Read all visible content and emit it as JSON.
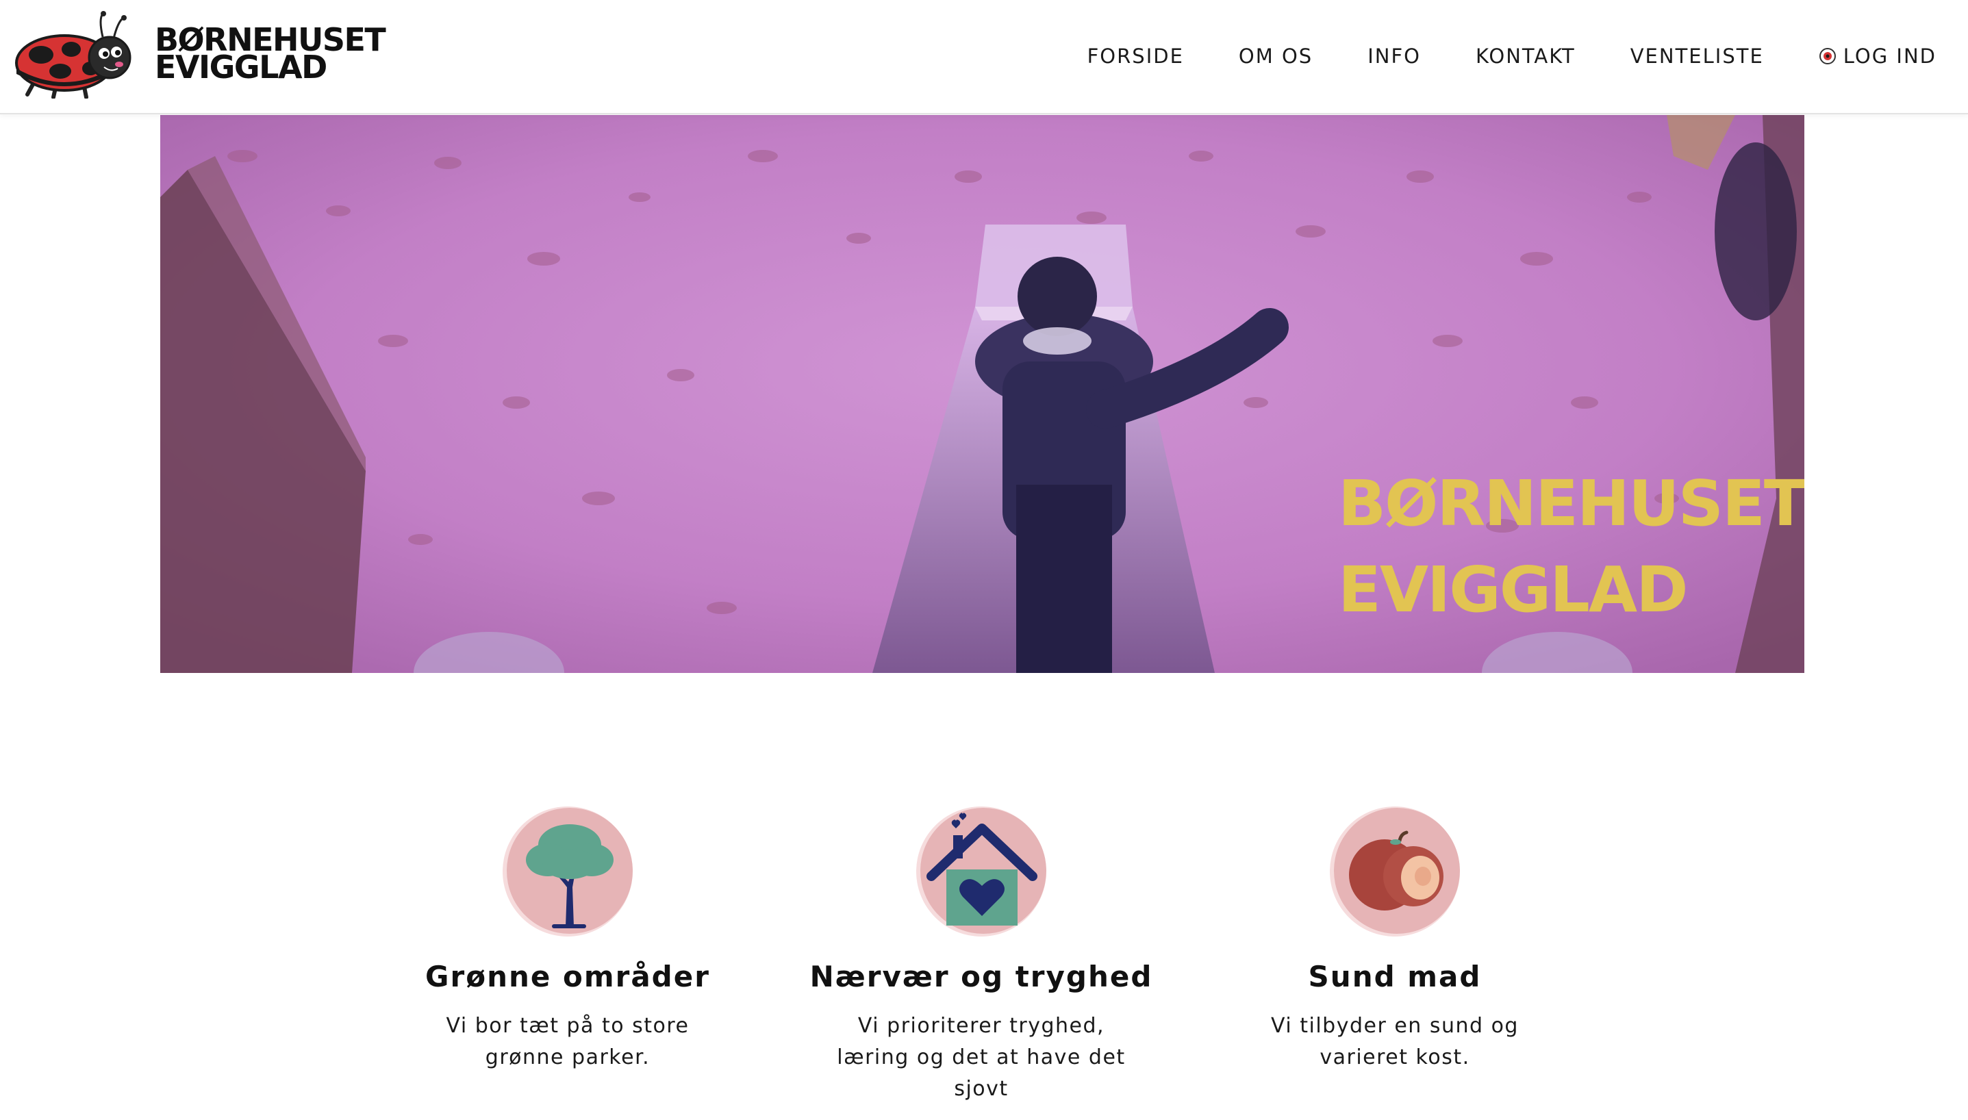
{
  "brand": {
    "line1": "BØRNEHUSET",
    "line2": "EVIGGLAD",
    "logo_icon": "ladybug-icon"
  },
  "nav": {
    "items": [
      {
        "label": "FORSIDE"
      },
      {
        "label": "OM OS"
      },
      {
        "label": "INFO"
      },
      {
        "label": "KONTAKT"
      },
      {
        "label": "VENTELISTE"
      }
    ],
    "login_label": "LOG IND",
    "login_icon": "ladybug-dot-icon"
  },
  "hero": {
    "title_line1": "BØRNEHUSET",
    "title_line2": "EVIGGLAD",
    "tint_color": "#c683c9",
    "title_color": "#e2c452"
  },
  "features": [
    {
      "icon": "tree-icon",
      "title": "Grønne områder",
      "text": "Vi bor tæt på to store grønne parker."
    },
    {
      "icon": "heart-house-icon",
      "title": "Nærvær og tryghed",
      "text": "Vi prioriterer tryghed, læring og det at have det sjovt"
    },
    {
      "icon": "apple-icon",
      "title": "Sund mad",
      "text": "Vi tilbyder en sund og varieret kost."
    }
  ],
  "colors": {
    "icon_circle": "#e6b4b6",
    "tree_green": "#5fa48e",
    "navy": "#1f2b6e",
    "apple_red": "#b24f45"
  }
}
